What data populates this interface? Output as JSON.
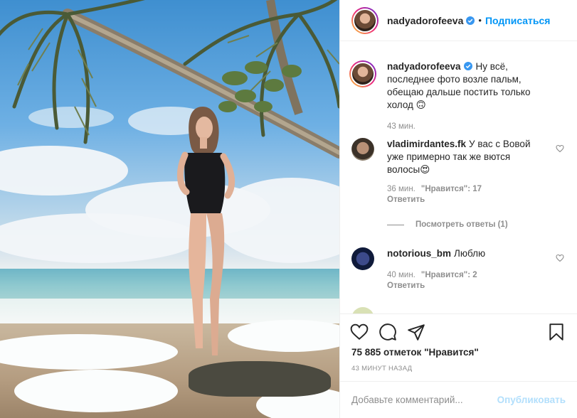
{
  "post": {
    "author": "nadyadorofeeva",
    "follow_label": "Подписаться",
    "separator": "•",
    "colors": {
      "accent": "#0095f6",
      "muted": "#8e8e8e",
      "text": "#262626",
      "publish_disabled": "#b2dffc"
    }
  },
  "caption": {
    "username": "nadyadorofeeva",
    "text": "Ну всё, последнее фото возле пальм, обещаю дальше постить только холод 🙃",
    "time": "43 мин."
  },
  "comments": [
    {
      "username": "vladimirdantes.fk",
      "text": "У вас с Вовой уже примерно так же вются волосы😍",
      "time": "36 мин.",
      "likes": "\"Нравится\": 17",
      "reply_label": "Ответить",
      "view_replies": "Посмотреть ответы (1)"
    },
    {
      "username": "notorious_bm",
      "text": "Люблю",
      "time": "40 мин.",
      "likes": "\"Нравится\": 2",
      "reply_label": "Ответить"
    }
  ],
  "actions": {
    "like_icon": "heart-icon",
    "comment_icon": "comment-icon",
    "share_icon": "paper-plane-icon",
    "save_icon": "bookmark-icon"
  },
  "likes_text": "75 885 отметок \"Нравится\"",
  "timestamp": "43 МИНУТ НАЗАД",
  "composer": {
    "placeholder": "Добавьте комментарий...",
    "publish_label": "Опубликовать"
  }
}
